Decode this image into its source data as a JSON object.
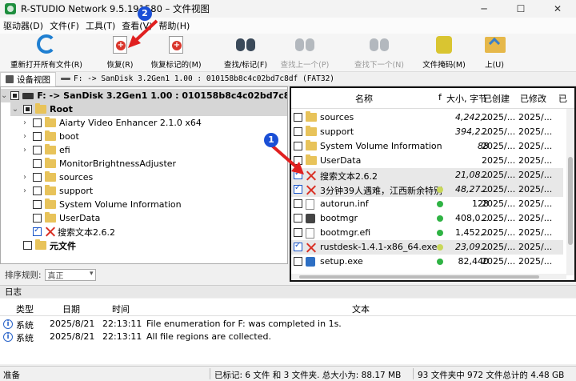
{
  "window": {
    "title": "R-STUDIO Network 9.5.191580 – 文件视图"
  },
  "menu": [
    "驱动器(D)",
    "文件(F)",
    "工具(T)",
    "查看(V)",
    "帮助(H)"
  ],
  "toolbar": [
    {
      "label": "重新打开所有文件(R)",
      "icon": "refresh-icon",
      "enabled": true
    },
    {
      "label": "恢复(R)",
      "icon": "recover-icon",
      "enabled": true
    },
    {
      "label": "恢复标记的(M)",
      "icon": "recover-marked-icon",
      "enabled": true
    },
    {
      "label": "查找/标记(F)",
      "icon": "binoculars-icon",
      "enabled": true
    },
    {
      "label": "查找上一个(P)",
      "icon": "binoculars-icon",
      "enabled": false
    },
    {
      "label": "查找下一个(N)",
      "icon": "binoculars-icon",
      "enabled": false
    },
    {
      "label": "文件掩码(M)",
      "icon": "file-mask-icon",
      "enabled": true
    },
    {
      "label": "上(U)",
      "icon": "up-folder-icon",
      "enabled": true
    }
  ],
  "markers": {
    "first": "1",
    "second": "2"
  },
  "tabs": {
    "device_view": "设备视图",
    "path": "F: -> SanDisk 3.2Gen1 1.00 : 010158b8c4c02bd7c8df (FAT32)"
  },
  "tree": {
    "drive": "F: -> SanDisk 3.2Gen1 1.00 : 010158b8c4c02bd7c8df (FAT32)",
    "root": "Root",
    "items": [
      "Aiarty Video Enhancer 2.1.0 x64",
      "boot",
      "efi",
      "MonitorBrightnessAdjuster",
      "sources",
      "support",
      "System Volume Information",
      "UserData",
      "搜索文本2.6.2"
    ],
    "meta": "元文件"
  },
  "file_columns": {
    "name": "名称",
    "flag": "f",
    "size": "大小, 字节",
    "created": "已创建",
    "modified": "已修改",
    "extra": "已"
  },
  "files": [
    {
      "name": "sources",
      "size": "4,242,...",
      "created": "2025/...",
      "modified": "2025/...",
      "checked": false,
      "type": "folder",
      "dot": ""
    },
    {
      "name": "support",
      "size": "394,2...",
      "created": "2025/...",
      "modified": "2025/...",
      "checked": false,
      "type": "folder",
      "dot": ""
    },
    {
      "name": "System Volume Information",
      "size": "88",
      "created": "2025/...",
      "modified": "2025/...",
      "checked": false,
      "type": "folder",
      "dot": ""
    },
    {
      "name": "UserData",
      "size": "",
      "created": "2025/...",
      "modified": "2025/...",
      "checked": false,
      "type": "folder",
      "dot": ""
    },
    {
      "name": "搜索文本2.6.2",
      "size": "21,08...",
      "created": "2025/...",
      "modified": "2025/...",
      "checked": true,
      "type": "deleted",
      "dot": ""
    },
    {
      "name": "3分钟39人遇难，江西新余特别",
      "size": "48,27...",
      "created": "2025/...",
      "modified": "2025/...",
      "checked": true,
      "type": "deleted",
      "dot": "lite"
    },
    {
      "name": "autorun.inf",
      "size": "128",
      "created": "2025/...",
      "modified": "2025/...",
      "checked": false,
      "type": "doc",
      "dot": "green"
    },
    {
      "name": "bootmgr",
      "size": "408,0...",
      "created": "2025/...",
      "modified": "2025/...",
      "checked": false,
      "type": "gear",
      "dot": "green"
    },
    {
      "name": "bootmgr.efi",
      "size": "1,452,...",
      "created": "2025/...",
      "modified": "2025/...",
      "checked": false,
      "type": "doc",
      "dot": "green"
    },
    {
      "name": "rustdesk-1.4.1-x86_64.exe",
      "size": "23,09...",
      "created": "2025/...",
      "modified": "2025/...",
      "checked": true,
      "type": "deleted",
      "dot": "lite"
    },
    {
      "name": "setup.exe",
      "size": "82,440",
      "created": "2025/...",
      "modified": "2025/...",
      "checked": false,
      "type": "blue",
      "dot": "green"
    }
  ],
  "sort": {
    "label": "排序规则:",
    "value": "真正"
  },
  "log": {
    "title": "日志",
    "columns": {
      "type": "类型",
      "date": "日期",
      "time": "时间",
      "text": "文本"
    },
    "rows": [
      {
        "type": "系统",
        "date": "2025/8/21",
        "time": "22:13:11",
        "text": "File enumeration for F: was completed in 1s."
      },
      {
        "type": "系统",
        "date": "2025/8/21",
        "time": "22:13:11",
        "text": "All file regions are collected."
      }
    ]
  },
  "status": {
    "ready": "准备",
    "marked": "已标记: 6 文件 和 3 文件夹. 总大小为: 88.17 MB",
    "total": "93 文件夹中 972 文件总计的 4.48 GB"
  },
  "colors": {
    "marker": "#1a4fd6",
    "deleted": "#d93025",
    "ok_dot": "#2fb344",
    "folder": "#e8c35a"
  }
}
